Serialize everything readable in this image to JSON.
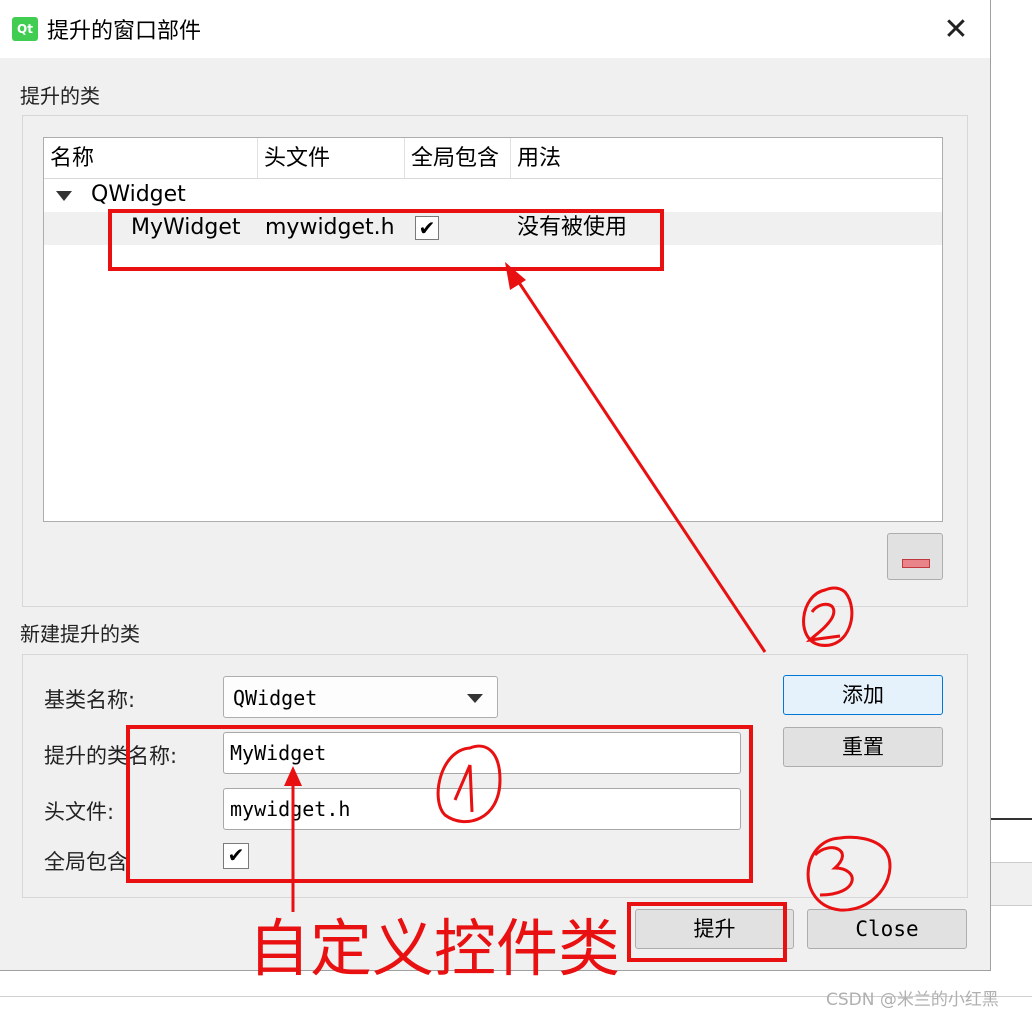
{
  "window": {
    "icon_text": "Qt",
    "title": "提升的窗口部件",
    "close_glyph": "✕"
  },
  "promoted": {
    "section_label": "提升的类",
    "columns": [
      "名称",
      "头文件",
      "全局包含",
      "用法"
    ],
    "group_name": "QWidget",
    "row": {
      "name": "MyWidget",
      "header": "mywidget.h",
      "global_include_glyph": "✔",
      "usage": "没有被使用"
    },
    "remove_icon": "minus-icon"
  },
  "new_class": {
    "section_label": "新建提升的类",
    "base_label": "基类名称:",
    "base_value": "QWidget",
    "class_label": "提升的类名称:",
    "class_value": "MyWidget",
    "header_label": "头文件:",
    "header_value": "mywidget.h",
    "global_label": "全局包含",
    "global_glyph": "✔",
    "add_label": "添加",
    "reset_label": "重置"
  },
  "buttons": {
    "promote_label": "提升",
    "close_label": "Close"
  },
  "annotations": {
    "caption": "自定义控件类",
    "color": "#e81010"
  },
  "watermark": "CSDN @米兰的小红黑"
}
